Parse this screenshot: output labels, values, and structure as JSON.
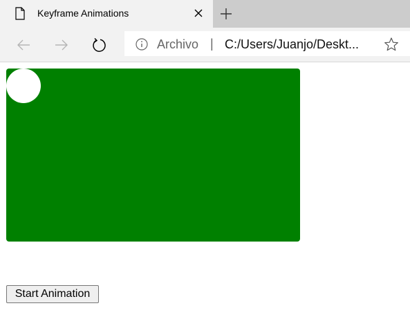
{
  "browser": {
    "tab": {
      "title": "Keyframe Animations"
    },
    "address": {
      "scheme_label": "Archivo",
      "separator": "|",
      "url": "C:/Users/Juanjo/Deskt..."
    }
  },
  "page": {
    "start_button_label": "Start Animation",
    "colors": {
      "stage": "#008000",
      "ball": "#ffffff"
    }
  }
}
